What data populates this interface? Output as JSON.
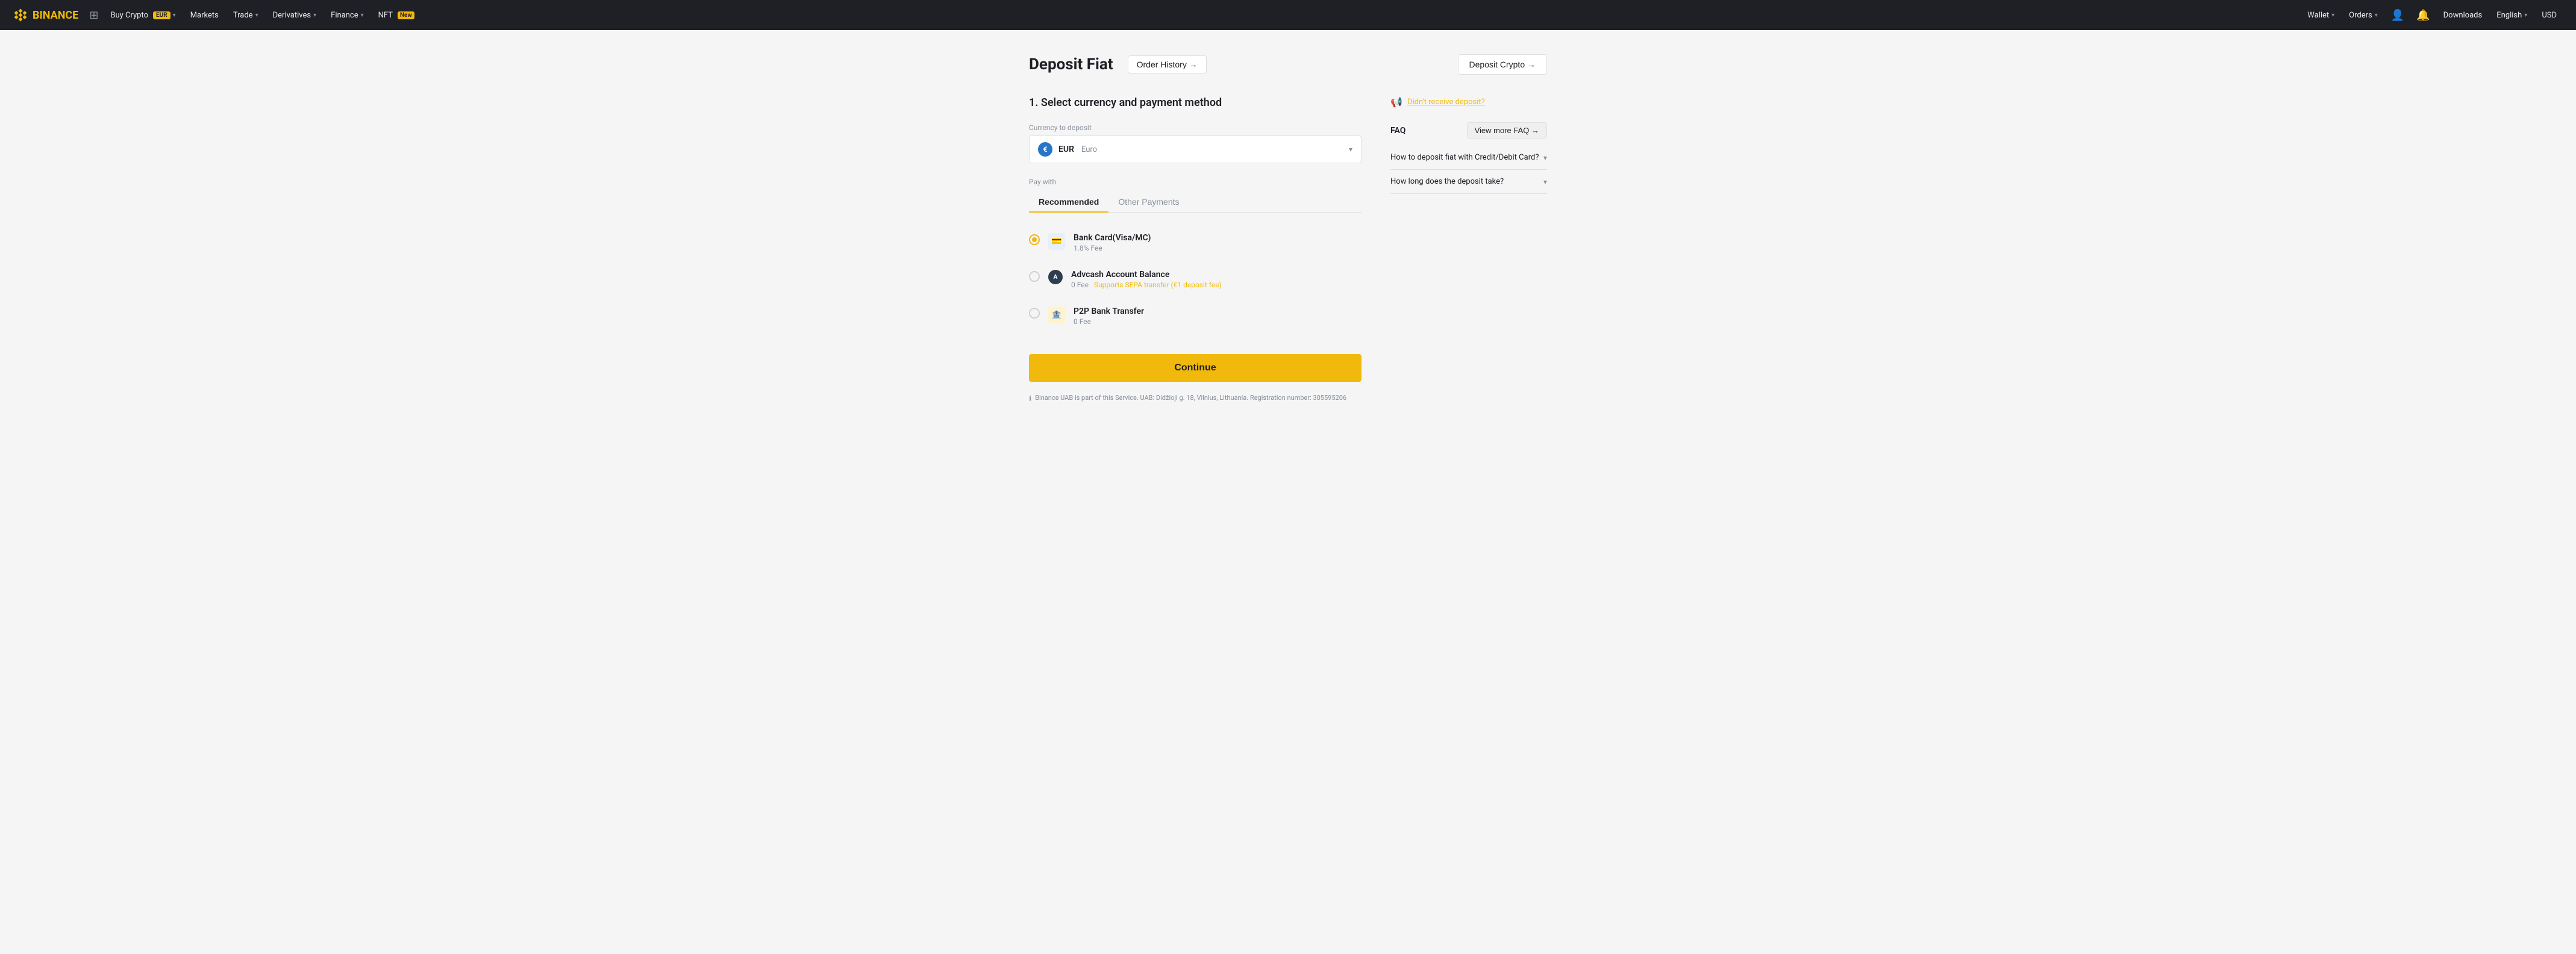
{
  "navbar": {
    "logo_text": "BINANCE",
    "buy_crypto": "Buy Crypto",
    "buy_crypto_badge": "EUR",
    "markets": "Markets",
    "trade": "Trade",
    "derivatives": "Derivatives",
    "finance": "Finance",
    "nft": "NFT",
    "nft_badge": "New",
    "wallet": "Wallet",
    "orders": "Orders",
    "downloads": "Downloads",
    "language": "English",
    "currency": "USD"
  },
  "page": {
    "title": "Deposit Fiat",
    "order_history_label": "Order History →",
    "deposit_crypto_label": "Deposit Crypto →",
    "section_title": "1. Select currency and payment method",
    "currency_label": "Currency to deposit",
    "currency_code": "EUR",
    "currency_name": "Euro",
    "currency_symbol": "€",
    "pay_with_label": "Pay with",
    "tab_recommended": "Recommended",
    "tab_other": "Other Payments",
    "payment_options": [
      {
        "name": "Bank Card(Visa/MC)",
        "fee": "1.8% Fee",
        "sepa": null,
        "icon_type": "card",
        "selected": true
      },
      {
        "name": "Advcash Account Balance",
        "fee": "0 Fee",
        "sepa": "Supports SEPA transfer (€1 deposit fee)",
        "icon_type": "adv",
        "selected": false
      },
      {
        "name": "P2P Bank Transfer",
        "fee": "0 Fee",
        "sepa": null,
        "icon_type": "p2p",
        "selected": false
      }
    ],
    "continue_label": "Continue",
    "footer_text": "Binance UAB is part of this Service. UAB: Didžioji g. 18, Vilnius, Lithuania. Registration number: 305595206"
  },
  "faq": {
    "label": "FAQ",
    "view_more": "View more FAQ →",
    "items": [
      {
        "question": "How to deposit fiat with Credit/Debit Card?"
      },
      {
        "question": "How long does the deposit take?"
      }
    ]
  },
  "alert": {
    "text": "Didn't receive deposit?"
  }
}
